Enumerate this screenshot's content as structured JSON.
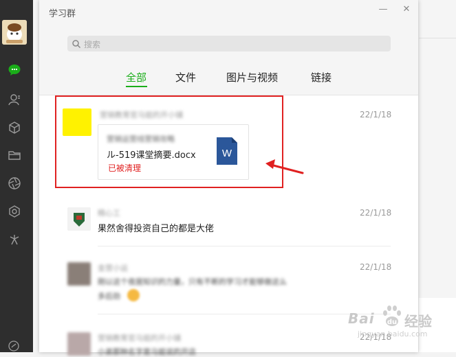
{
  "window": {
    "title": "学习群",
    "minimize_label": "—",
    "close_label": "✕"
  },
  "search": {
    "placeholder": "搜索"
  },
  "tabs": [
    {
      "label": "全部",
      "active": true
    },
    {
      "label": "文件",
      "active": false
    },
    {
      "label": "图片与视频",
      "active": false
    },
    {
      "label": "链接",
      "active": false
    }
  ],
  "sidebar": {
    "icons": [
      "chat-icon",
      "contacts-icon",
      "collections-icon",
      "folder-icon",
      "moments-icon",
      "mini-program-icon",
      "discover-icon",
      "phone-icon"
    ]
  },
  "messages": [
    {
      "sender": "营销教育官马姐的开小铺",
      "date": "22/1/18",
      "type": "file",
      "file_name_top": "营销运营线营销攻略",
      "file_name": "ル-519课堂摘要.docx",
      "file_status": "已被清理",
      "file_icon": "W"
    },
    {
      "sender": "精心工",
      "date": "22/1/18",
      "type": "text",
      "text": "果然舍得投资自己的都是大佬"
    },
    {
      "sender": "金营小运",
      "date": "22/1/18",
      "type": "text",
      "text_line1": "刚以这个夜居知识的力量，只有不断的学习才能够做这么",
      "text_line2": "多后劲"
    },
    {
      "sender": "营销教育官马姐的开小铺",
      "date": "22/1/18",
      "type": "text",
      "text": "小弟那种名字是马姐说的开店"
    }
  ],
  "watermark": {
    "brand": "Bai",
    "brand_tail": "du",
    "product": "经验",
    "url": "jingyan.baidu.com"
  },
  "colors": {
    "accent": "#1aad19",
    "highlight_box": "#e02020",
    "file_cleared": "#e02020",
    "word_blue": "#2b579a"
  }
}
